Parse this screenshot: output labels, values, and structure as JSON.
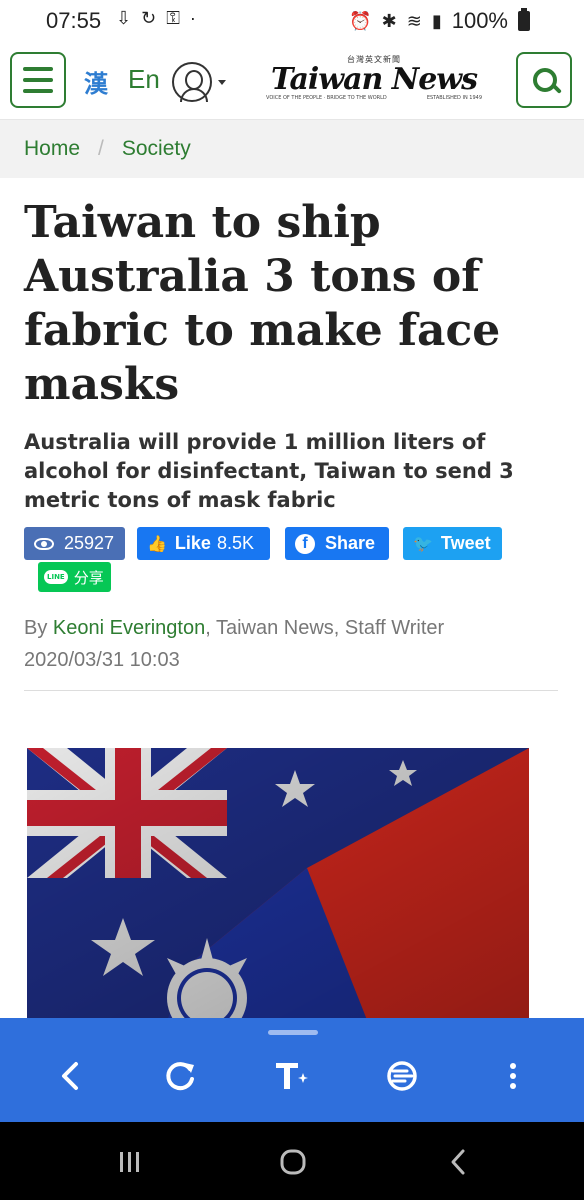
{
  "status_bar": {
    "time": "07:55",
    "battery": "100%"
  },
  "header": {
    "lang_chinese": "漢",
    "lang_english": "En",
    "logo_text": "Taiwan News",
    "logo_chinese": "台灣英文新聞",
    "logo_tagline": "VOICE OF THE PEOPLE · BRIDGE TO THE WORLD",
    "logo_established": "ESTABLISHED IN 1949"
  },
  "breadcrumb": {
    "home": "Home",
    "separator": "/",
    "section": "Society"
  },
  "article": {
    "title": "Taiwan to ship Australia 3 tons of fabric to make face masks",
    "subtitle": "Australia will provide 1 million liters of alcohol for disinfectant, Taiwan to send 3 metric tons of mask fabric",
    "views": "25927",
    "like_label": "Like",
    "like_count": "8.5K",
    "share_label": "Share",
    "tweet_label": "Tweet",
    "line_label": "LINE",
    "line_share": "分享",
    "byline_prefix": "By",
    "author": "Keoni Everington",
    "byline_suffix": ", Taiwan News, Staff Writer",
    "date": "2020/03/31 10:03"
  },
  "colors": {
    "accent_green": "#2e7d32",
    "toolbar_blue": "#2f6fdc",
    "facebook_blue": "#1877f2",
    "twitter_blue": "#1da1f2",
    "line_green": "#06c755"
  }
}
